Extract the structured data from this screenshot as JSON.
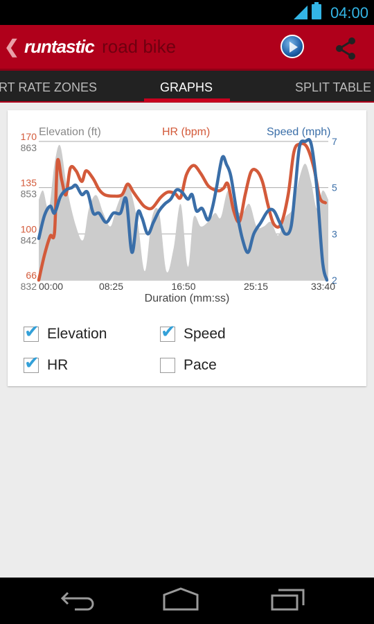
{
  "status_bar": {
    "time": "04:00",
    "icons": [
      "signal-icon",
      "battery-icon"
    ]
  },
  "action_bar": {
    "back_glyph": "❮",
    "brand": "runtastic",
    "product": "road bike",
    "icons": [
      "globe-play-icon",
      "share-icon"
    ]
  },
  "tabs": [
    {
      "label": "RT RATE ZONES",
      "active": false
    },
    {
      "label": "GRAPHS",
      "active": true
    },
    {
      "label": "SPLIT TABLE",
      "active": false
    }
  ],
  "checkboxes": [
    {
      "label": "Elevation",
      "checked": true
    },
    {
      "label": "Speed",
      "checked": true
    },
    {
      "label": "HR",
      "checked": true
    },
    {
      "label": "Pace",
      "checked": false
    }
  ],
  "colors": {
    "brand_red": "#b0001b",
    "hr": "#d35a3a",
    "speed": "#3a6ea8",
    "elevation": "#cccccc",
    "accent": "#33b5e5"
  },
  "chart_data": {
    "type": "line",
    "title": "",
    "xlabel": "Duration (mm:ss)",
    "x_ticks": [
      "00:00",
      "08:25",
      "16:50",
      "25:15",
      "33:40"
    ],
    "x_range_seconds": [
      0,
      2020
    ],
    "grid": true,
    "series": [
      {
        "name": "Elevation (ft)",
        "axis": "left-inner",
        "style": "area",
        "ticks": [
          "863",
          "853",
          "842",
          "832"
        ],
        "range": [
          832,
          863
        ],
        "x": [
          0,
          30,
          70,
          110,
          150,
          200,
          260,
          310,
          350,
          400,
          450,
          500,
          540,
          590,
          630,
          690,
          740,
          790,
          840,
          890,
          940,
          990,
          1040,
          1080,
          1130,
          1180,
          1230,
          1270,
          1320,
          1370,
          1420,
          1470,
          1520,
          1570,
          1620,
          1670,
          1720,
          1770,
          1820,
          1860,
          1900,
          1940,
          1980,
          2020
        ],
        "values": [
          850,
          852,
          848,
          858,
          862,
          852,
          844,
          841,
          848,
          851,
          847,
          844,
          848,
          852,
          853,
          845,
          834,
          846,
          847,
          834,
          839,
          849,
          835,
          846,
          844,
          845,
          847,
          846,
          852,
          848,
          847,
          849,
          844,
          844,
          845,
          842,
          846,
          848,
          855,
          858,
          854,
          848,
          852,
          850
        ]
      },
      {
        "name": "HR (bpm)",
        "axis": "left-outer",
        "style": "line",
        "ticks": [
          "170",
          "135",
          "100",
          "66"
        ],
        "range": [
          66,
          170
        ],
        "x": [
          0,
          40,
          80,
          110,
          130,
          160,
          190,
          220,
          260,
          300,
          330,
          380,
          420,
          460,
          520,
          580,
          620,
          660,
          700,
          740,
          790,
          850,
          900,
          950,
          990,
          1030,
          1080,
          1130,
          1180,
          1220,
          1260,
          1290,
          1320,
          1360,
          1400,
          1440,
          1480,
          1520,
          1560,
          1600,
          1640,
          1690,
          1740,
          1780,
          1820,
          1870,
          1920,
          1960,
          2000
        ],
        "values": [
          66,
          85,
          99,
          102,
          155,
          141,
          130,
          150,
          148,
          140,
          148,
          142,
          134,
          130,
          129,
          130,
          138,
          132,
          126,
          121,
          120,
          128,
          132,
          131,
          128,
          145,
          152,
          146,
          137,
          134,
          133,
          135,
          138,
          118,
          110,
          130,
          147,
          148,
          140,
          122,
          108,
          108,
          130,
          162,
          168,
          166,
          150,
          128,
          124
        ]
      },
      {
        "name": "Speed (mph)",
        "axis": "right",
        "style": "line",
        "ticks": [
          "7",
          "5",
          "3",
          "2"
        ],
        "range": [
          2,
          7
        ],
        "x": [
          0,
          40,
          80,
          110,
          150,
          190,
          230,
          260,
          300,
          340,
          380,
          420,
          470,
          520,
          570,
          610,
          650,
          690,
          720,
          760,
          800,
          840,
          880,
          920,
          960,
          1000,
          1040,
          1070,
          1100,
          1140,
          1180,
          1210,
          1240,
          1280,
          1310,
          1340,
          1380,
          1420,
          1460,
          1500,
          1550,
          1600,
          1640,
          1680,
          1720,
          1760,
          1790,
          1820,
          1860,
          1900,
          1940,
          1980,
          2010
        ],
        "values": [
          2.9,
          3.8,
          4.2,
          3.9,
          4.6,
          4.9,
          5.0,
          5.1,
          4.7,
          4.8,
          3.9,
          3.9,
          3.5,
          3.9,
          3.9,
          4.5,
          2.6,
          3.9,
          3.7,
          3.0,
          3.5,
          4.0,
          4.3,
          4.5,
          4.9,
          4.8,
          4.5,
          4.7,
          4.0,
          4.1,
          3.6,
          4.1,
          5.0,
          6.3,
          6.0,
          5.5,
          4.0,
          2.9,
          2.6,
          3.0,
          3.5,
          4.0,
          4.0,
          3.5,
          3.0,
          3.3,
          5.0,
          6.8,
          7.0,
          6.9,
          5.0,
          2.4,
          2.0
        ]
      }
    ],
    "legend": "top"
  }
}
